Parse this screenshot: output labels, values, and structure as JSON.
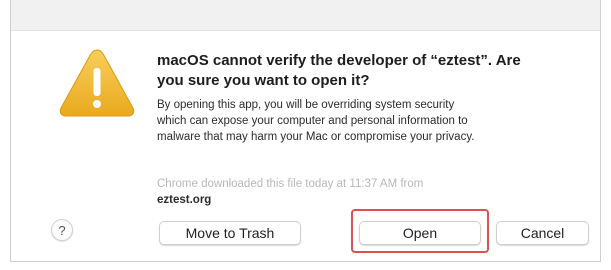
{
  "dialog": {
    "icon": "warning-triangle-icon",
    "heading": "macOS cannot verify the developer of “eztest”. Are\nyou sure you want to open it?",
    "body": "By opening this app, you will be overriding system security\nwhich can expose your computer and personal information to\nmalware that may harm your Mac or compromise your privacy.",
    "source_line": "Chrome downloaded this file today at 11:37 AM from",
    "source_domain": "eztest.org",
    "help_label": "?",
    "buttons": {
      "move_to_trash": "Move to Trash",
      "open": "Open",
      "cancel": "Cancel"
    },
    "highlight_color": "#d9534f",
    "warning_color": "#f2b632"
  }
}
